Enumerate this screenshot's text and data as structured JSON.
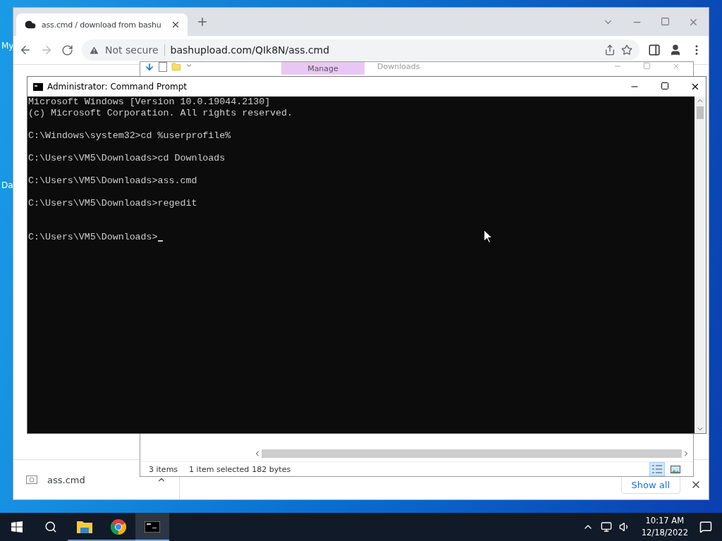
{
  "desktop": {
    "icon_labels": [
      "My",
      "Da"
    ]
  },
  "browser": {
    "tab": {
      "title": "ass.cmd / download from bashu",
      "selected": true
    },
    "security": "Not secure",
    "url": "bashupload.com/QIk8N/ass.cmd",
    "download": {
      "file": "ass.cmd"
    },
    "show_all": "Show all"
  },
  "explorer": {
    "ribbon_tabs": [
      {
        "label": "Manage",
        "selected": true
      }
    ],
    "title": "Downloads",
    "status": [
      "3 items",
      "1 item selected",
      "182 bytes"
    ],
    "views": [
      {
        "kind": "details",
        "selected": true
      },
      {
        "kind": "preview",
        "selected": false
      }
    ]
  },
  "console": {
    "title": "Administrator: Command Prompt",
    "blocks": [
      [
        "Microsoft Windows [Version 10.0.19044.2130]",
        "(c) Microsoft Corporation. All rights reserved."
      ],
      [
        "C:\\Windows\\system32>cd %userprofile%"
      ],
      [
        "C:\\Users\\VM5\\Downloads>cd Downloads"
      ],
      [
        "C:\\Users\\VM5\\Downloads>ass.cmd"
      ],
      [
        "C:\\Users\\VM5\\Downloads>regedit"
      ]
    ],
    "prompt": "C:\\Users\\VM5\\Downloads>"
  },
  "taskbar": {
    "apps": [
      {
        "kind": "explorer",
        "active": false
      },
      {
        "kind": "chrome",
        "active": false
      },
      {
        "kind": "console",
        "active": true
      }
    ],
    "time": "10:17 AM",
    "date": "12/18/2022"
  }
}
